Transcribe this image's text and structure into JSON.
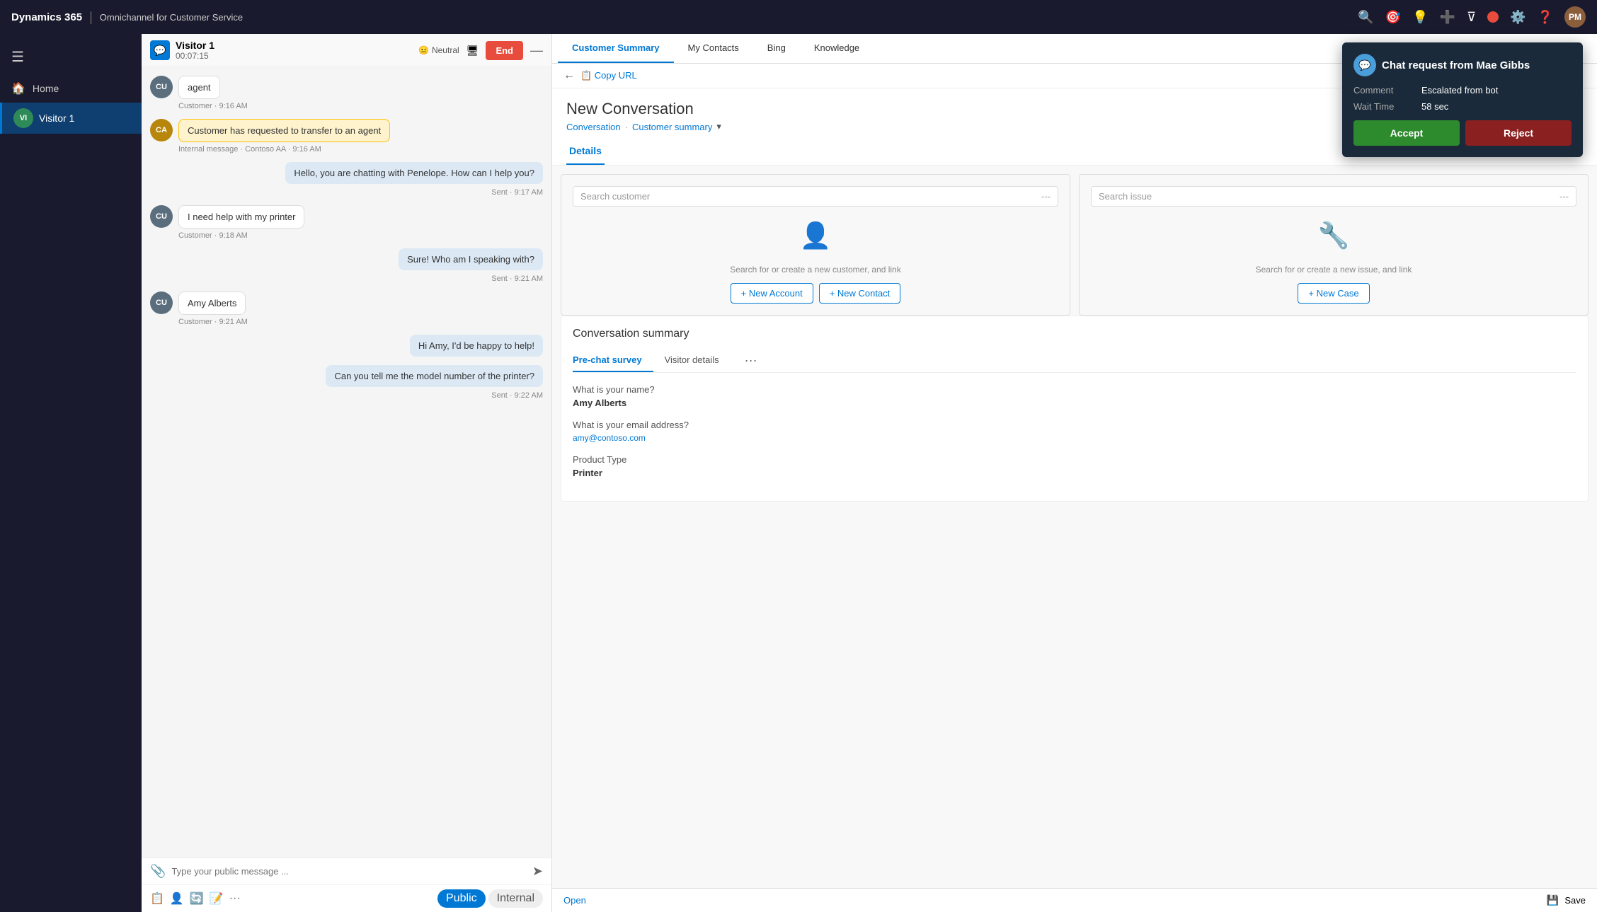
{
  "app": {
    "brand": "Dynamics 365",
    "divider": "|",
    "app_name": "Omnichannel for Customer Service"
  },
  "top_nav": {
    "icons": [
      "🔍",
      "🎯",
      "💡",
      "➕",
      "🔽",
      "⚙️",
      "❓"
    ],
    "avatar_label": "PM"
  },
  "sidebar": {
    "hamburger": "☰",
    "home_label": "Home",
    "visitor_label": "Visitor 1",
    "visitor_initials": "VI"
  },
  "chat_panel": {
    "visitor_name": "Visitor 1",
    "timer": "00:07:15",
    "sentiment": "Neutral",
    "minimize_icon": "—",
    "end_button": "End",
    "messages": [
      {
        "type": "agent",
        "avatar": "CU",
        "text": "agent",
        "meta": "Customer · 9:16 AM",
        "align": "left"
      },
      {
        "type": "internal",
        "avatar": "CA",
        "text": "Customer has requested to transfer to an agent",
        "meta": "Internal message · Contoso AA · 9:16 AM",
        "align": "left"
      },
      {
        "type": "sent",
        "text": "Hello, you are chatting with Penelope. How can I help you?",
        "meta": "Sent · 9:17 AM",
        "align": "right"
      },
      {
        "type": "customer",
        "avatar": "CU",
        "text": "I need help with my printer",
        "meta": "Customer · 9:18 AM",
        "align": "left"
      },
      {
        "type": "sent",
        "text": "Sure! Who am I speaking with?",
        "meta": "Sent · 9:21 AM",
        "align": "right"
      },
      {
        "type": "customer",
        "avatar": "CU",
        "text": "Amy Alberts",
        "meta": "Customer · 9:21 AM",
        "align": "left"
      },
      {
        "type": "sent",
        "text": "Hi Amy, I'd be happy to help!",
        "meta": "",
        "align": "right"
      },
      {
        "type": "sent",
        "text": "Can you tell me the model number of the printer?",
        "meta": "Sent · 9:22 AM",
        "align": "right"
      }
    ],
    "input_placeholder": "Type your public message ...",
    "mode_public": "Public",
    "mode_internal": "Internal"
  },
  "right_panel": {
    "tabs": [
      {
        "label": "Customer Summary",
        "active": true
      },
      {
        "label": "My Contacts",
        "active": false
      },
      {
        "label": "Bing",
        "active": false
      },
      {
        "label": "Knowledge",
        "active": false
      }
    ],
    "copy_url": "Copy URL",
    "back_icon": "←",
    "panel_title": "New Conversation",
    "breadcrumb_1": "Conversation",
    "breadcrumb_sep": "·",
    "breadcrumb_2": "Customer summary",
    "breadcrumb_dropdown": "▾",
    "details_tab": "Details",
    "customer_search": {
      "placeholder": "Search customer",
      "dots": "---",
      "empty_icon": "👤",
      "empty_text": "Search for or create a new customer, and link",
      "btn_new_account": "+ New Account",
      "btn_new_contact": "+ New Contact"
    },
    "issue_search": {
      "placeholder": "Search issue",
      "dots": "---",
      "empty_icon": "🔧",
      "empty_text": "Search for or create a new issue, and link",
      "btn_new_case": "+ New Case"
    },
    "conversation_summary": {
      "title": "Conversation summary",
      "tab_prechat": "Pre-chat survey",
      "tab_visitor": "Visitor details",
      "tab_more": "···",
      "fields": [
        {
          "label": "What is your name?",
          "value": "Amy Alberts"
        },
        {
          "label": "What is your email address?",
          "value": "amy@contoso.com",
          "is_email": true
        },
        {
          "label": "Product Type",
          "value": "Printer"
        }
      ]
    }
  },
  "notification": {
    "avatar_icon": "💬",
    "title": "Chat request from Mae Gibbs",
    "comment_label": "Comment",
    "comment_value": "Escalated from bot",
    "wait_label": "Wait Time",
    "wait_value": "58 sec",
    "accept_label": "Accept",
    "reject_label": "Reject"
  },
  "bottom_bar": {
    "open_label": "Open",
    "save_label": "Save"
  }
}
